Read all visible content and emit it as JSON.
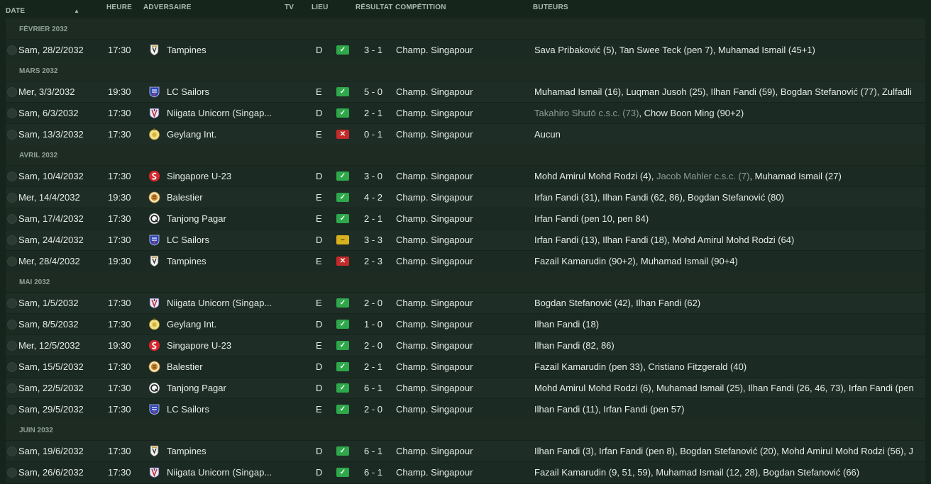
{
  "columns": {
    "date": "DATE",
    "time": "HEURE",
    "opponent": "ADVERSAIRE",
    "tv": "TV",
    "venue": "LIEU",
    "result": "RÉSULTAT",
    "competition": "COMPÉTITION",
    "scorers": "BUTEURS"
  },
  "colors": {
    "win": "#2ea84a",
    "loss": "#c42a2a",
    "draw": "#d8b21c"
  },
  "groups": [
    {
      "month": "FÉVRIER 2032",
      "matches": [
        {
          "date": "Sam, 28/2/2032",
          "time": "17:30",
          "opponent": "Tampines",
          "crest": "tampines",
          "venue": "D",
          "outcome": "win",
          "score": "3 - 1",
          "competition": "Champ. Singapour",
          "scorers": [
            {
              "text": "Sava Pribaković (5), Tan Swee Teck (pen 7), Muhamad Ismail (45+1)",
              "own_goal": false
            }
          ]
        }
      ]
    },
    {
      "month": "MARS 2032",
      "matches": [
        {
          "date": "Mer, 3/3/2032",
          "time": "19:30",
          "opponent": "LC Sailors",
          "crest": "sailors",
          "venue": "E",
          "outcome": "win",
          "score": "5 - 0",
          "competition": "Champ. Singapour",
          "scorers": [
            {
              "text": "Muhamad Ismail (16), Luqman Jusoh (25), Ilhan Fandi (59), Bogdan Stefanović (77), Zulfadli",
              "own_goal": false
            }
          ]
        },
        {
          "date": "Sam, 6/3/2032",
          "time": "17:30",
          "opponent": "Niigata Unicorn (Singap...",
          "crest": "niigata",
          "venue": "D",
          "outcome": "win",
          "score": "2 - 1",
          "competition": "Champ. Singapour",
          "scorers": [
            {
              "text": "Takahiro Shutō c.s.c. (73)",
              "own_goal": true
            },
            {
              "text": ", Chow Boon Ming (90+2)",
              "own_goal": false
            }
          ]
        },
        {
          "date": "Sam, 13/3/2032",
          "time": "17:30",
          "opponent": "Geylang Int.",
          "crest": "geylang",
          "venue": "E",
          "outcome": "loss",
          "score": "0 - 1",
          "competition": "Champ. Singapour",
          "scorers": [
            {
              "text": "Aucun",
              "own_goal": false
            }
          ]
        }
      ]
    },
    {
      "month": "AVRIL 2032",
      "matches": [
        {
          "date": "Sam, 10/4/2032",
          "time": "17:30",
          "opponent": "Singapore U-23",
          "crest": "u23",
          "venue": "D",
          "outcome": "win",
          "score": "3 - 0",
          "competition": "Champ. Singapour",
          "scorers": [
            {
              "text": "Mohd Amirul Mohd Rodzi (4), ",
              "own_goal": false
            },
            {
              "text": "Jacob Mahler c.s.c. (7)",
              "own_goal": true
            },
            {
              "text": ", Muhamad Ismail (27)",
              "own_goal": false
            }
          ]
        },
        {
          "date": "Mer, 14/4/2032",
          "time": "19:30",
          "opponent": "Balestier",
          "crest": "balestier",
          "venue": "E",
          "outcome": "win",
          "score": "4 - 2",
          "competition": "Champ. Singapour",
          "scorers": [
            {
              "text": "Irfan Fandi (31), Ilhan Fandi (62, 86), Bogdan Stefanović (80)",
              "own_goal": false
            }
          ]
        },
        {
          "date": "Sam, 17/4/2032",
          "time": "17:30",
          "opponent": "Tanjong Pagar",
          "crest": "tanjong",
          "venue": "E",
          "outcome": "win",
          "score": "2 - 1",
          "competition": "Champ. Singapour",
          "scorers": [
            {
              "text": "Irfan Fandi (pen 10, pen 84)",
              "own_goal": false
            }
          ]
        },
        {
          "date": "Sam, 24/4/2032",
          "time": "17:30",
          "opponent": "LC Sailors",
          "crest": "sailors",
          "venue": "D",
          "outcome": "draw",
          "score": "3 - 3",
          "competition": "Champ. Singapour",
          "scorers": [
            {
              "text": "Irfan Fandi (13), Ilhan Fandi (18), Mohd Amirul Mohd Rodzi (64)",
              "own_goal": false
            }
          ]
        },
        {
          "date": "Mer, 28/4/2032",
          "time": "19:30",
          "opponent": "Tampines",
          "crest": "tampines",
          "venue": "E",
          "outcome": "loss",
          "score": "2 - 3",
          "competition": "Champ. Singapour",
          "scorers": [
            {
              "text": "Fazail Kamarudin (90+2), Muhamad Ismail (90+4)",
              "own_goal": false
            }
          ]
        }
      ]
    },
    {
      "month": "MAI 2032",
      "matches": [
        {
          "date": "Sam, 1/5/2032",
          "time": "17:30",
          "opponent": "Niigata Unicorn (Singap...",
          "crest": "niigata",
          "venue": "E",
          "outcome": "win",
          "score": "2 - 0",
          "competition": "Champ. Singapour",
          "scorers": [
            {
              "text": "Bogdan Stefanović (42), Ilhan Fandi (62)",
              "own_goal": false
            }
          ]
        },
        {
          "date": "Sam, 8/5/2032",
          "time": "17:30",
          "opponent": "Geylang Int.",
          "crest": "geylang",
          "venue": "D",
          "outcome": "win",
          "score": "1 - 0",
          "competition": "Champ. Singapour",
          "scorers": [
            {
              "text": "Ilhan Fandi (18)",
              "own_goal": false
            }
          ]
        },
        {
          "date": "Mer, 12/5/2032",
          "time": "19:30",
          "opponent": "Singapore U-23",
          "crest": "u23",
          "venue": "E",
          "outcome": "win",
          "score": "2 - 0",
          "competition": "Champ. Singapour",
          "scorers": [
            {
              "text": "Ilhan Fandi (82, 86)",
              "own_goal": false
            }
          ]
        },
        {
          "date": "Sam, 15/5/2032",
          "time": "17:30",
          "opponent": "Balestier",
          "crest": "balestier",
          "venue": "D",
          "outcome": "win",
          "score": "2 - 1",
          "competition": "Champ. Singapour",
          "scorers": [
            {
              "text": "Fazail Kamarudin (pen 33), Cristiano Fitzgerald (40)",
              "own_goal": false
            }
          ]
        },
        {
          "date": "Sam, 22/5/2032",
          "time": "17:30",
          "opponent": "Tanjong Pagar",
          "crest": "tanjong",
          "venue": "D",
          "outcome": "win",
          "score": "6 - 1",
          "competition": "Champ. Singapour",
          "scorers": [
            {
              "text": "Mohd Amirul Mohd Rodzi (6), Muhamad Ismail (25), Ilhan Fandi (26, 46, 73), Irfan Fandi (pen",
              "own_goal": false
            }
          ]
        },
        {
          "date": "Sam, 29/5/2032",
          "time": "17:30",
          "opponent": "LC Sailors",
          "crest": "sailors",
          "venue": "E",
          "outcome": "win",
          "score": "2 - 0",
          "competition": "Champ. Singapour",
          "scorers": [
            {
              "text": "Ilhan Fandi (11), Irfan Fandi (pen 57)",
              "own_goal": false
            }
          ]
        }
      ]
    },
    {
      "month": "JUIN 2032",
      "matches": [
        {
          "date": "Sam, 19/6/2032",
          "time": "17:30",
          "opponent": "Tampines",
          "crest": "tampines",
          "venue": "D",
          "outcome": "win",
          "score": "6 - 1",
          "competition": "Champ. Singapour",
          "scorers": [
            {
              "text": "Ilhan Fandi (3), Irfan Fandi (pen 8), Bogdan Stefanović (20), Mohd Amirul Mohd Rodzi (56), J",
              "own_goal": false
            }
          ]
        },
        {
          "date": "Sam, 26/6/2032",
          "time": "17:30",
          "opponent": "Niigata Unicorn (Singap...",
          "crest": "niigata",
          "venue": "D",
          "outcome": "win",
          "score": "6 - 1",
          "competition": "Champ. Singapour",
          "scorers": [
            {
              "text": "Fazail Kamarudin (9, 51, 59), Muhamad Ismail (12, 28), Bogdan Stefanović (66)",
              "own_goal": false
            }
          ]
        }
      ]
    }
  ]
}
